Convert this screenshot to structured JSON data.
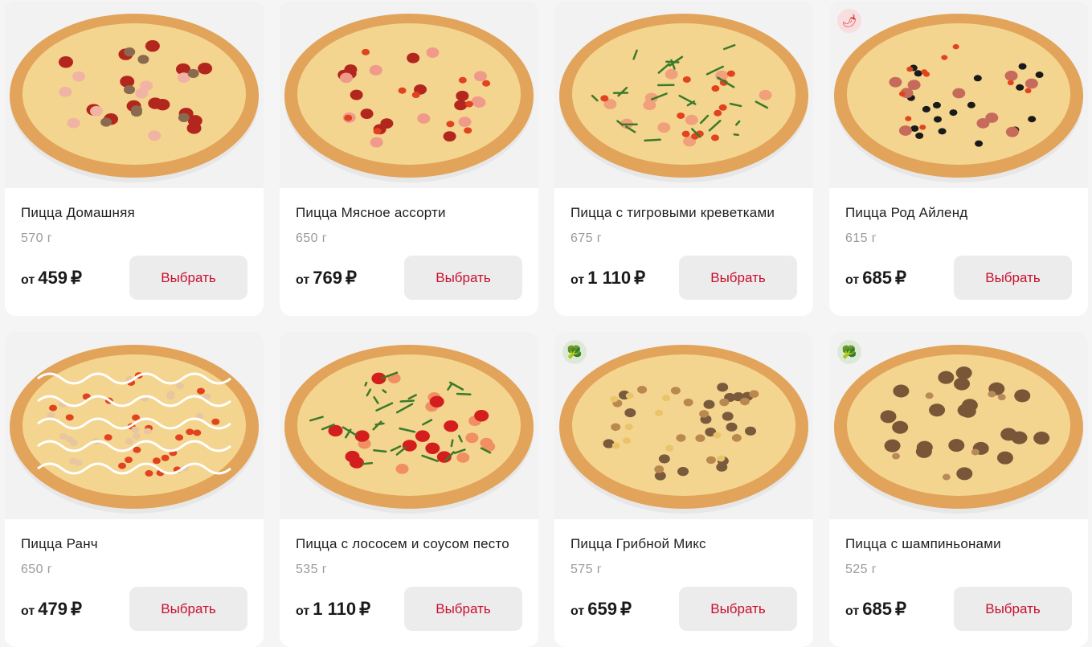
{
  "products": [
    {
      "title": "Пицца Домашняя",
      "weight": "570 г",
      "from": "от",
      "price": "459",
      "currency": "₽",
      "button": "Выбрать",
      "badge": "",
      "topping": "pepperoni"
    },
    {
      "title": "Пицца Мясное ассорти",
      "weight": "650 г",
      "from": "от",
      "price": "769",
      "currency": "₽",
      "button": "Выбрать",
      "badge": "",
      "topping": "meat"
    },
    {
      "title": "Пицца с тигровыми креветками",
      "weight": "675 г",
      "from": "от",
      "price": "1 110",
      "currency": "₽",
      "button": "Выбрать",
      "badge": "",
      "topping": "shrimp"
    },
    {
      "title": "Пицца Род Айленд",
      "weight": "615 г",
      "from": "от",
      "price": "685",
      "currency": "₽",
      "button": "Выбрать",
      "badge": "spicy",
      "topping": "olives"
    },
    {
      "title": "Пицца Ранч",
      "weight": "650 г",
      "from": "от",
      "price": "479",
      "currency": "₽",
      "button": "Выбрать",
      "badge": "",
      "topping": "ranch"
    },
    {
      "title": "Пицца с лососем и соусом песто",
      "weight": "535 г",
      "from": "от",
      "price": "1 110",
      "currency": "₽",
      "button": "Выбрать",
      "badge": "",
      "topping": "salmon"
    },
    {
      "title": "Пицца Грибной Микс",
      "weight": "575 г",
      "from": "от",
      "price": "659",
      "currency": "₽",
      "button": "Выбрать",
      "badge": "vegetarian",
      "topping": "mushroom-mix"
    },
    {
      "title": "Пицца с шампиньонами",
      "weight": "525 г",
      "from": "от",
      "price": "685",
      "currency": "₽",
      "button": "Выбрать",
      "badge": "vegetarian",
      "topping": "champignon"
    }
  ],
  "badge_icons": {
    "spicy": "chili-pepper-icon",
    "vegetarian": "broccoli-icon"
  },
  "colors": {
    "accent": "#c8102e",
    "button_bg": "#ececec",
    "muted": "#9a9a9a",
    "crust": "#e2a45a",
    "cheese": "#f4d58f"
  }
}
